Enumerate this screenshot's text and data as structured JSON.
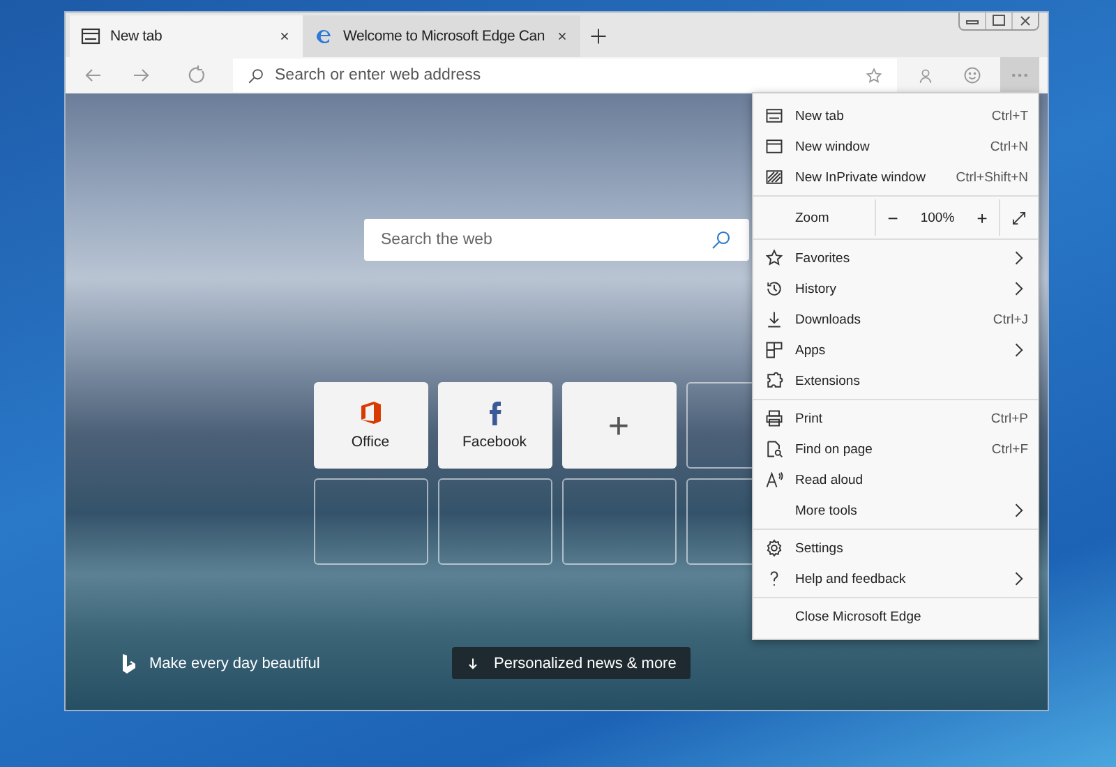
{
  "tabs": [
    {
      "title": "New tab",
      "selected": true
    },
    {
      "title": "Welcome to Microsoft Edge Can",
      "selected": false
    }
  ],
  "address_bar": {
    "placeholder": "Search or enter web address"
  },
  "new_tab_page": {
    "search": {
      "placeholder": "Search the web"
    },
    "tiles": [
      {
        "kind": "site",
        "label": "Office"
      },
      {
        "kind": "site",
        "label": "Facebook"
      },
      {
        "kind": "add",
        "label": "+"
      },
      {
        "kind": "empty"
      },
      {
        "kind": "empty"
      },
      {
        "kind": "empty"
      },
      {
        "kind": "empty"
      },
      {
        "kind": "empty"
      }
    ],
    "tagline": "Make every day beautiful",
    "news_button": "Personalized news & more"
  },
  "menu": {
    "sections": [
      [
        {
          "kind": "item",
          "label": "New tab",
          "shortcut": "Ctrl+T"
        },
        {
          "kind": "item",
          "label": "New window",
          "shortcut": "Ctrl+N"
        },
        {
          "kind": "item",
          "label": "New InPrivate window",
          "shortcut": "Ctrl+Shift+N"
        }
      ],
      [
        {
          "kind": "zoom",
          "label": "Zoom",
          "minus": "−",
          "value": "100%",
          "plus": "+"
        }
      ],
      [
        {
          "kind": "item",
          "label": "Favorites",
          "submenu": true
        },
        {
          "kind": "item",
          "label": "History",
          "submenu": true
        },
        {
          "kind": "item",
          "label": "Downloads",
          "shortcut": "Ctrl+J"
        },
        {
          "kind": "item",
          "label": "Apps",
          "submenu": true
        },
        {
          "kind": "item",
          "label": "Extensions"
        }
      ],
      [
        {
          "kind": "item",
          "label": "Print",
          "shortcut": "Ctrl+P"
        },
        {
          "kind": "item",
          "label": "Find on page",
          "shortcut": "Ctrl+F"
        },
        {
          "kind": "item",
          "label": "Read aloud"
        },
        {
          "kind": "item",
          "label": "More tools",
          "submenu": true
        }
      ],
      [
        {
          "kind": "item",
          "label": "Settings"
        },
        {
          "kind": "item",
          "label": "Help and feedback",
          "submenu": true
        }
      ],
      [
        {
          "kind": "item",
          "label": "Close Microsoft Edge"
        }
      ]
    ]
  }
}
